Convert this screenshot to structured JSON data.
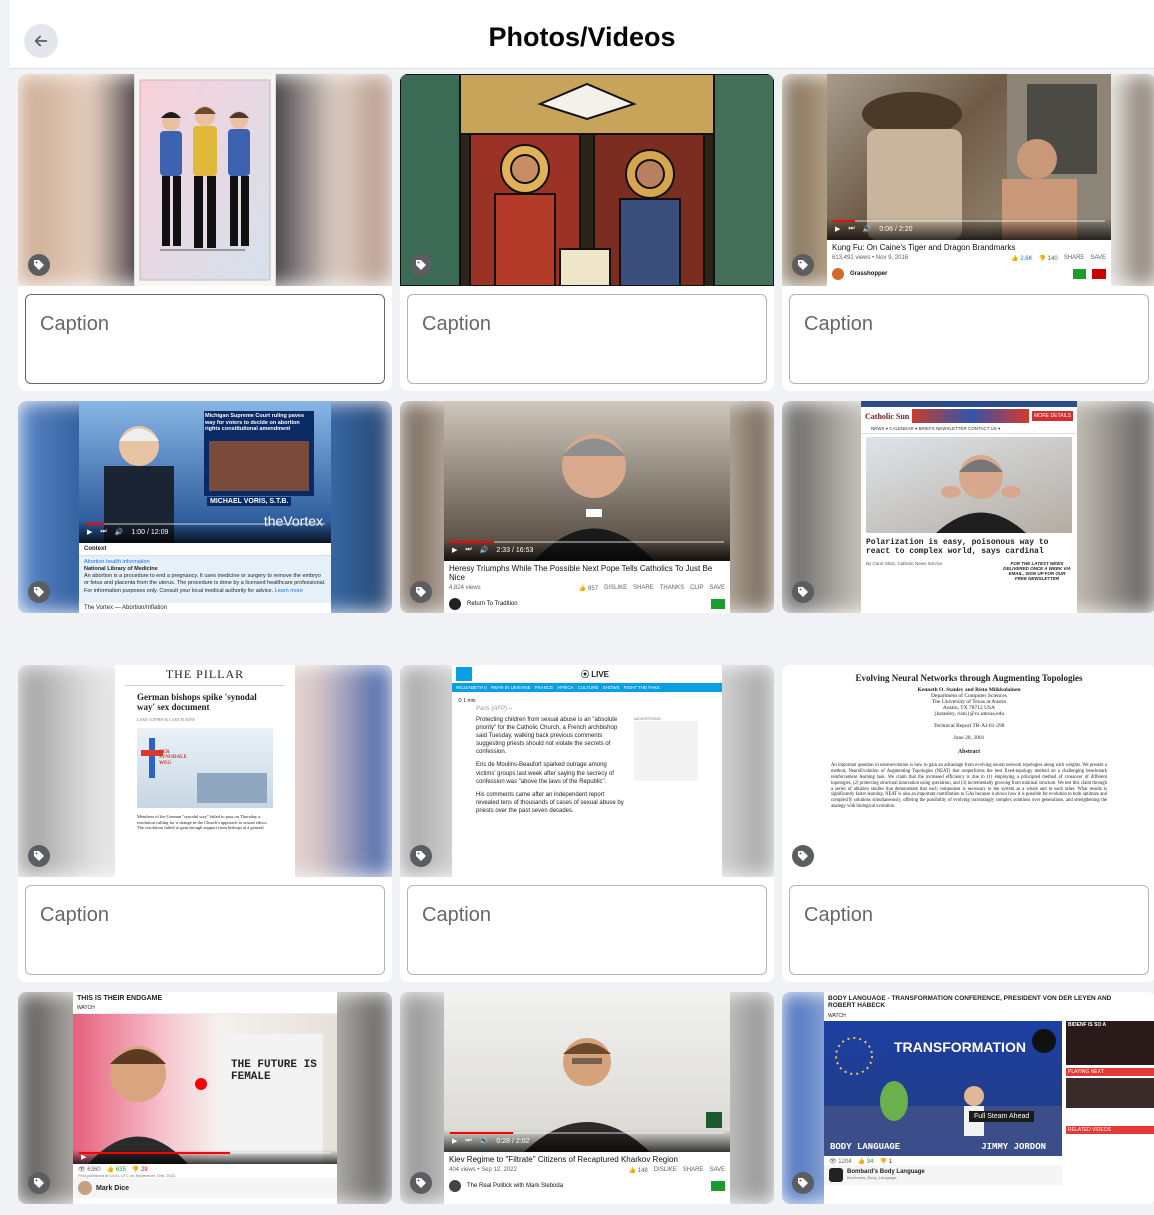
{
  "header": {
    "title": "Photos/Videos"
  },
  "caption_placeholder": "Caption",
  "colors": {
    "accent": "#1877f2",
    "youtube_red": "#ff0000",
    "green": "#1a9d2d"
  },
  "icons": {
    "back": "arrow-left-icon",
    "tag": "tag-icon"
  },
  "items": [
    {
      "id": "startrek",
      "kind": "image"
    },
    {
      "id": "stainedglass",
      "kind": "image"
    },
    {
      "id": "kungfu",
      "kind": "video",
      "video_title": "Kung Fu: On Caine's Tiger and Dragon Brandmarks",
      "video_meta": "613,491 views • Nov 9, 2016",
      "likes": "2.6K",
      "dislikes": "140",
      "share": "SHARE",
      "save": "SAVE",
      "time": "0:06 / 2:20",
      "channel": "Grasshopper"
    },
    {
      "id": "vortex",
      "kind": "video",
      "headline": "Michigan Supreme Court ruling paves way for voters to decide on abortion rights constitutional amendment",
      "presenter": "MICHAEL VORIS, S.T.B.",
      "brand": "theVortex",
      "time": "1:00 / 12:09",
      "context_label": "Context",
      "context_title": "Abortion health information",
      "context_source": "National Library of Medicine",
      "context_body": "An abortion is a procedure to end a pregnancy. It uses medicine or surgery to remove the embryo or fetus and placenta from the uterus. The procedure is done by a licensed healthcare professional.",
      "context_footer": "For information purposes only. Consult your local medical authority for advice.",
      "context_link": "Learn more",
      "video_title": "The Vortex — Abortion/Inflation"
    },
    {
      "id": "heresy",
      "kind": "video",
      "time": "2:33 / 16:53",
      "video_title": "Heresy Triumphs While The Possible Next Pope Tells Catholics To Just Be Nice",
      "video_meta": "4,824 views",
      "likes": "857",
      "dislike": "DISLIKE",
      "share": "SHARE",
      "thanks": "THANKS",
      "clip": "CLIP",
      "save": "SAVE",
      "channel": "Return To Tradition"
    },
    {
      "id": "catholicsun",
      "kind": "article",
      "site": "Catholic Sun",
      "banner": "MORE DETAILS",
      "nav": "NEWS ▾   CALENDAR ▾   BRIEFS   NEWSLETTER   CONTACT US ▾",
      "headline": "Polarization is easy, poisonous way to react to complex world, says cardinal",
      "byline": "By Carol Glatz, Catholic News Service",
      "promo": "FOR THE LATEST NEWS DELIVERED ONCE A WEEK VIA EMAIL, SIGN UP FOR OUR FREE NEWSLETTER"
    },
    {
      "id": "pillar",
      "kind": "article",
      "site": "THE PILLAR",
      "headline": "German bishops spike 'synodal way' sex document",
      "byline": "LUKE COPPEN & LUKE ELKINS",
      "graphic_text": "DER SYNODALE WEG",
      "body": "Members of the German \"synodal way\" failed to pass on Thursday a resolution calling for a change in the Church's approach to sexual ethics. The resolution failed to gain enough support from bishops at a general"
    },
    {
      "id": "france24",
      "kind": "article",
      "live": "LIVE",
      "nav": [
        "#ELIZABETH II",
        "#WAR IN UKRAINE",
        "FRANCE",
        "AFRICA",
        "CULTURE",
        "SHOWS",
        "FIGHT THE FAKE"
      ],
      "read_time": "1 min",
      "dateline": "Paris (AFP) –",
      "ad_label": "ADVERTISING",
      "p1": "Protecting children from sexual abuse is an \"absolute priority\" for the Catholic Church, a French archbishop said Tuesday, walking back previous comments suggesting priests should not violate the secrets of confession.",
      "p2": "Eric de Moulins-Beaufort sparked outrage among victims' groups last week after saying the secrecy of confession was \"above the laws of the Republic\".",
      "p3": "His comments came after an independent report revealed tens of thousands of cases of sexual abuse by priests over the past seven decades."
    },
    {
      "id": "neat",
      "kind": "document",
      "title": "Evolving Neural Networks through Augmenting Topologies",
      "authors": "Kenneth O. Stanley and Risto Miikkulainen",
      "affiliation": "Department of Computer Sciences",
      "university": "The University of Texas at Austin",
      "address": "Austin, TX 78712 USA",
      "emails": "{kstanley, risto}@cs.utexas.edu",
      "report": "Technical Report TR-AI-01-290",
      "date": "June 28, 2001",
      "abstract_heading": "Abstract",
      "abstract": "An important question in neuroevolution is how to gain an advantage from evolving neural network topologies along with weights. We present a method, NeuroEvolution of Augmenting Topologies (NEAT) that outperforms the best fixed-topology method on a challenging benchmark reinforcement learning task. We claim that the increased efficiency is due to (1) employing a principled method of crossover of different topologies, (2) protecting structural innovation using speciation, and (3) incrementally growing from minimal structure. We test this claim through a series of ablation studies that demonstrate that each component is necessary to the system as a whole and to each other. What results is significantly faster learning. NEAT is also an important contribution to GAs because it shows how it is possible for evolution to both optimize and complexify solutions simultaneously, offering the possibility of evolving increasingly complex solutions over generations, and strengthening the analogy with biological evolution."
    },
    {
      "id": "endgame",
      "kind": "video",
      "headline": "THIS IS THEIR ENDGAME",
      "watch": "WATCH",
      "shirt_text": "THE FUTURE IS FEMALE",
      "views": "6360",
      "likes": "635",
      "dislikes": "29",
      "published": "First published at 14:41 UTC on September 15th, 2022.",
      "channel": "Mark Dice"
    },
    {
      "id": "kiev",
      "kind": "video",
      "time": "0:28 / 2:02",
      "video_title": "Kiev Regime to \"Filtrate\" Citizens of Recaptured Kharkov Region",
      "video_meta": "404 views • Sep 12, 2022",
      "likes": "148",
      "dislike": "DISLIKE",
      "share": "SHARE",
      "save": "SAVE",
      "channel": "The Real Politick with Mark Sleboda"
    },
    {
      "id": "bodylanguage",
      "kind": "video",
      "headline": "BODY LANGUAGE - TRANSFORMATION CONFERENCE, PRESIDENT VON DER LEYEN AND ROBERT HABECK",
      "watch": "WATCH",
      "screen_text": "TRANSFORMATION",
      "lower_third": "Full Steam Ahead",
      "overlay_left": "BODY LANGUAGE",
      "overlay_right": "JIMMY JORDON",
      "views": "1204",
      "likes": "34",
      "dislikes": "1",
      "playing_next": "PLAYING NEXT",
      "related": "RELATED VIDEOS",
      "side_label": "BIDENF IS SO A",
      "channel": "Bombard's Body Language",
      "channel_handle": "Bombards_Body_Language"
    }
  ]
}
